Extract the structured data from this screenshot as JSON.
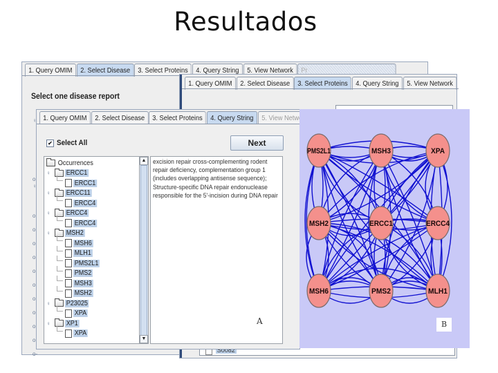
{
  "slide": {
    "title": "Resultados"
  },
  "back_window": {
    "tabs": [
      {
        "label": "1. Query OMIM",
        "state": "normal"
      },
      {
        "label": "2. Select Disease",
        "state": "active"
      },
      {
        "label": "3. Select Proteins",
        "state": "normal"
      },
      {
        "label": "4. Query String",
        "state": "normal"
      },
      {
        "label": "5. View Network",
        "state": "normal"
      },
      {
        "label": "Pr",
        "state": "partial"
      }
    ],
    "heading": "Select one disease report"
  },
  "middle_window": {
    "tabs": [
      {
        "label": "1. Query OMIM",
        "state": "normal"
      },
      {
        "label": "2. Select Disease",
        "state": "normal"
      },
      {
        "label": "3. Select Proteins",
        "state": "active"
      },
      {
        "label": "4. Query String",
        "state": "normal"
      },
      {
        "label": "5. View Network",
        "state": "normal"
      }
    ],
    "bottom_item": "S0082"
  },
  "front_window": {
    "tabs": [
      {
        "label": "1. Query OMIM",
        "state": "normal"
      },
      {
        "label": "2. Select Disease",
        "state": "normal"
      },
      {
        "label": "3. Select Proteins",
        "state": "normal"
      },
      {
        "label": "4. Query String",
        "state": "active"
      },
      {
        "label": "5. View Network",
        "state": "disabled"
      }
    ],
    "select_all_label": "Select All",
    "select_all_checked": true,
    "next_label": "Next",
    "tree": {
      "root": "Occurrences",
      "groups": [
        {
          "name": "ERCC1",
          "children": [
            "ERCC1"
          ]
        },
        {
          "name": "ERCC11",
          "children": [
            "ERCC4"
          ]
        },
        {
          "name": "ERCC4",
          "children": [
            "ERCC4"
          ]
        },
        {
          "name": "MSH2",
          "children": [
            "MSH6",
            "MLH1",
            "PMS2L1",
            "PMS2",
            "MSH3",
            "MSH2"
          ]
        },
        {
          "name": "P23025",
          "children": [
            "XPA"
          ]
        },
        {
          "name": "XP1",
          "children": [
            "XPA"
          ]
        }
      ]
    },
    "description_lines": [
      "excision repair cross-complementing rodent",
      "repair deficiency, complementation group 1",
      "(includes overlapping antisense sequence);",
      "Structure-specific DNA repair endonuclease",
      "responsible for the 5'-incision during DNA repair"
    ],
    "figure_label": "A"
  },
  "network": {
    "figure_label": "B",
    "colors": {
      "background": "#c9c9f7",
      "node_fill": "#f4908c",
      "node_stroke": "#7a6a6a",
      "edge": "#1010d0"
    },
    "nodes": [
      {
        "id": "PMS2L1",
        "row": 0,
        "col": 0
      },
      {
        "id": "MSH3",
        "row": 0,
        "col": 1
      },
      {
        "id": "XPA",
        "row": 0,
        "col": 2
      },
      {
        "id": "MSH2",
        "row": 1,
        "col": 0
      },
      {
        "id": "ERCC1",
        "row": 1,
        "col": 1
      },
      {
        "id": "ERCC4",
        "row": 1,
        "col": 2
      },
      {
        "id": "MSH6",
        "row": 2,
        "col": 0
      },
      {
        "id": "PMS2",
        "row": 2,
        "col": 1
      },
      {
        "id": "MLH1",
        "row": 2,
        "col": 2
      }
    ]
  }
}
